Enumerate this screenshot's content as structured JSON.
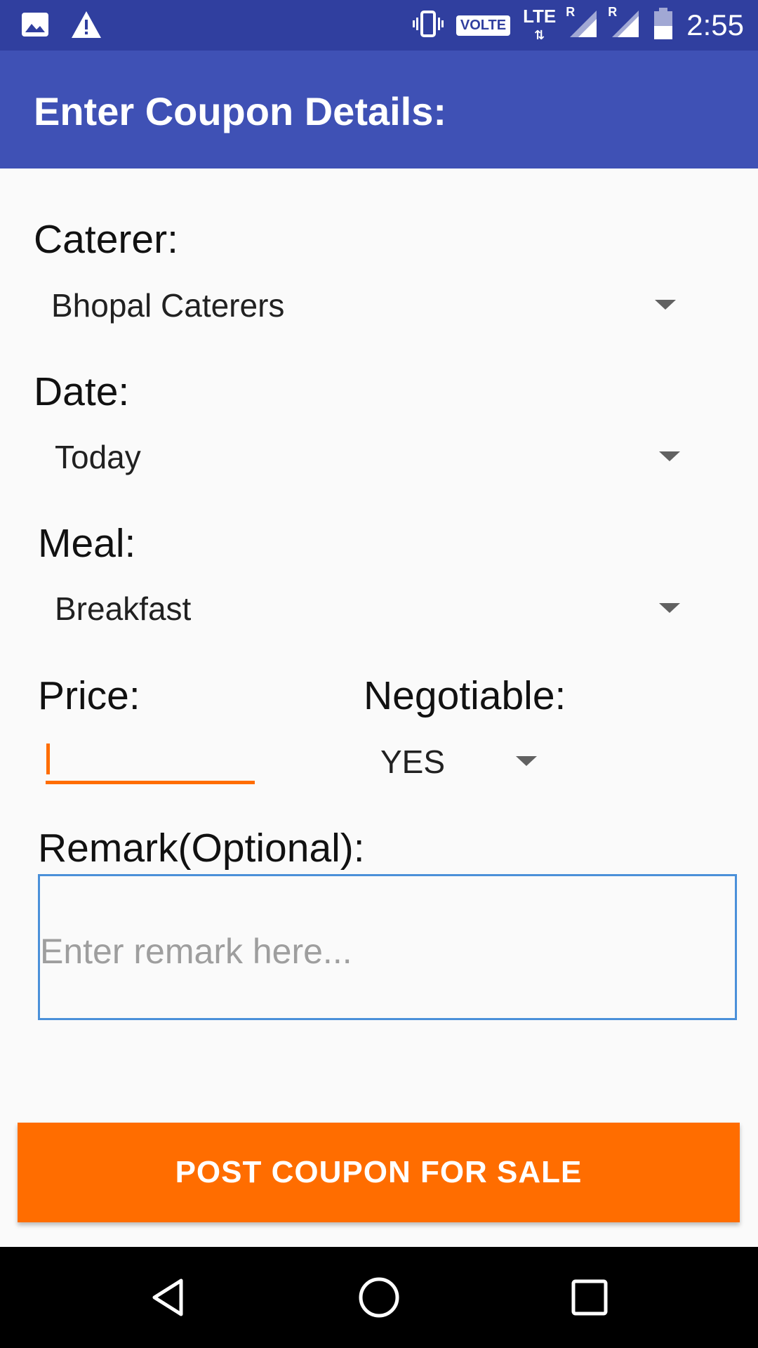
{
  "status_bar": {
    "time": "2:55",
    "volte": "VOLTE",
    "lte": "LTE",
    "roaming_marker_1": "R",
    "roaming_marker_2": "R",
    "icons": [
      "image-icon",
      "warning-icon",
      "vibrate-icon",
      "signal-icon",
      "signal-icon",
      "battery-icon"
    ]
  },
  "toolbar": {
    "title": "Enter Coupon Details:"
  },
  "form": {
    "caterer_label": "Caterer:",
    "caterer_value": "Bhopal Caterers",
    "date_label": "Date:",
    "date_value": "Today",
    "meal_label": "Meal:",
    "meal_value": "Breakfast",
    "price_label": "Price:",
    "price_value": "",
    "negotiable_label": "Negotiable:",
    "negotiable_value": "YES",
    "remark_label": "Remark(Optional):",
    "remark_placeholder": "Enter remark here..."
  },
  "actions": {
    "post_label": "POST COUPON FOR SALE"
  },
  "colors": {
    "status_bar": "#303f9f",
    "toolbar": "#3f51b5",
    "accent": "#ff6d00",
    "remark_border": "#4a90d9"
  },
  "nav_bar": {
    "icons": [
      "back-icon",
      "home-icon",
      "recents-icon"
    ]
  }
}
